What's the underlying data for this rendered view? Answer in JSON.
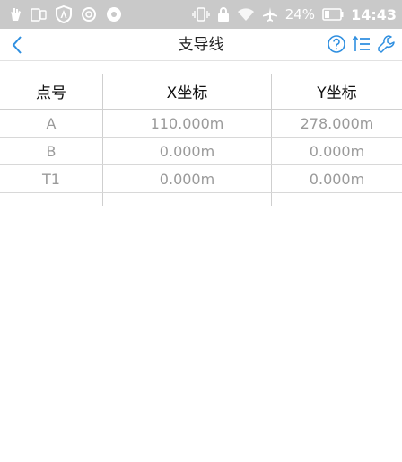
{
  "status_bar": {
    "battery_percent": "24%",
    "time": "14:43"
  },
  "nav": {
    "title": "支导线"
  },
  "table": {
    "headers": [
      "点号",
      "X坐标",
      "Y坐标"
    ],
    "rows": [
      [
        "A",
        "110.000m",
        "278.000m"
      ],
      [
        "B",
        "0.000m",
        "0.000m"
      ],
      [
        "T1",
        "0.000m",
        "0.000m"
      ]
    ]
  },
  "colors": {
    "accent": "#2f8fe0",
    "status_bar_bg": "#c9c9c9",
    "cell_text": "#9a9a9a"
  }
}
